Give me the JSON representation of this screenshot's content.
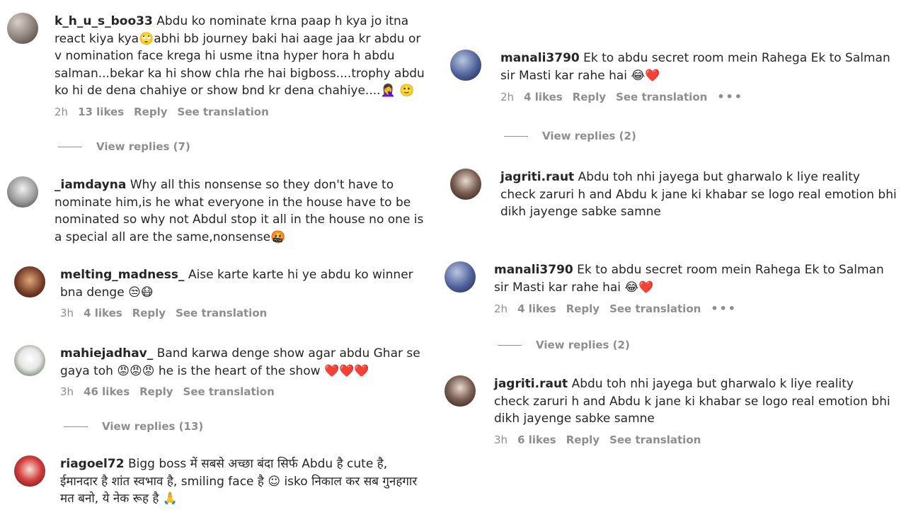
{
  "left": {
    "comments": [
      {
        "username": "k_h_u_s_boo33",
        "text": "Abdu ko nominate krna paap h kya jo itna react kiya kya🙄abhi bb journey baki hai aage jaa kr abdu or v nomination face krega hi usme itna hyper hora h abdu salman...bekar ka hi show chla rhe hai bigboss....trophy abdu ko hi de dena chahiye or show bnd kr dena chahiye....🤦‍♀️ 🙂",
        "time": "2h",
        "likes": "13 likes",
        "reply": "Reply",
        "translation": "See translation",
        "view_replies": "View replies (7)"
      },
      {
        "username": "_iamdayna",
        "text": "Why all this nonsense so they don't have to nominate him,is he what everyone in the house have to be nominated so why not Abdul stop it all in the house no one is a special all are the same,nonsense🤬"
      },
      {
        "username": "melting_madness_",
        "text": "Aise karte karte hi ye abdu ko winner bna denge 😒😷",
        "time": "3h",
        "likes": "4 likes",
        "reply": "Reply",
        "translation": "See translation"
      },
      {
        "username": "mahiejadhav_",
        "text": "Band karwa denge show agar abdu Ghar se gaya toh 😡😡😡 he is the heart of the show ❤️❤️❤️",
        "time": "3h",
        "likes": "46 likes",
        "reply": "Reply",
        "translation": "See translation",
        "view_replies": "View replies (13)"
      },
      {
        "username": "riagoel72",
        "text": "Bigg boss में सबसे अच्छा बंदा सिर्फ Abdu है cute है, ईमानदार है शांत स्वभाव है, smiling face है ☺ isko निकाल कर सब गुनहगार मत बनो, ये नेक रूह है 🙏"
      }
    ]
  },
  "right": {
    "comments": [
      {
        "username": "manali3790",
        "text": "Ek to abdu secret room mein Rahega Ek to Salman sir Masti kar rahe hai 😂❤️",
        "time": "2h",
        "likes": "4 likes",
        "reply": "Reply",
        "translation": "See translation",
        "more": "•••",
        "view_replies": "View replies (2)"
      },
      {
        "username": "jagriti.raut",
        "text": "Abdu toh nhi jayega but gharwalo k liye reality check zaruri h and Abdu k jane ki khabar se logo real emotion bhi dikh jayenge sabke samne"
      },
      {
        "username": "manali3790",
        "text": "Ek to abdu secret room mein Rahega Ek to Salman sir Masti kar rahe hai 😂❤️",
        "time": "2h",
        "likes": "4 likes",
        "reply": "Reply",
        "translation": "See translation",
        "more": "•••",
        "view_replies": "View replies (2)"
      },
      {
        "username": "jagriti.raut",
        "text": "Abdu toh nhi jayega but gharwalo k liye reality check zaruri h and Abdu k jane ki khabar se logo real emotion bhi dikh jayenge sabke samne",
        "time": "3h",
        "likes": "6 likes",
        "reply": "Reply",
        "translation": "See translation"
      }
    ]
  }
}
